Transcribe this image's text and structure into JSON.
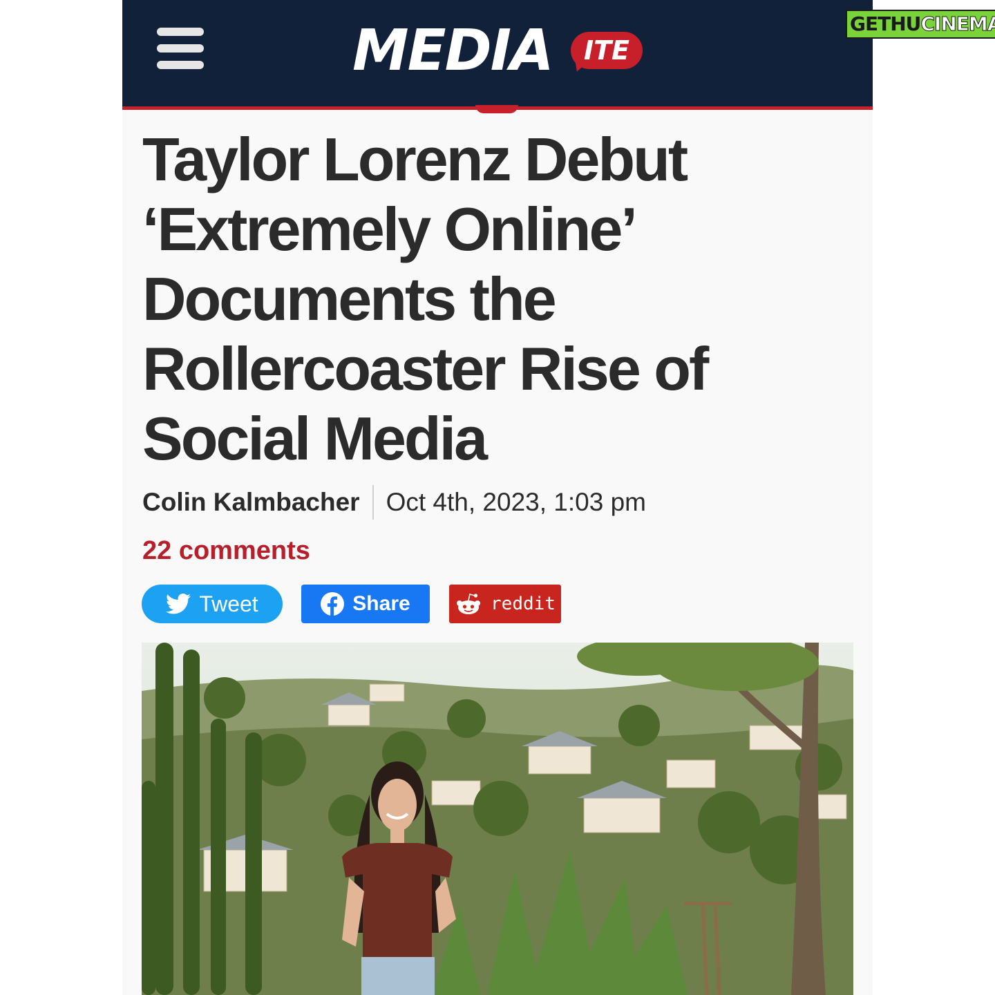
{
  "header": {
    "logo_main": "MEDIA",
    "logo_bubble": "ITE"
  },
  "watermark": {
    "part1": "GETHU",
    "part2": "CINEMA"
  },
  "article": {
    "headline": "Taylor Lorenz Debut ‘Extremely Online’ Documents the Rollercoaster Rise of Social Media",
    "author": "Colin Kalmbacher",
    "date": "Oct 4th, 2023, 1:03 pm",
    "comments": "22 comments"
  },
  "share": {
    "tweet_label": "Tweet",
    "facebook_label": "Share",
    "reddit_label": "reddit"
  },
  "colors": {
    "header_bg": "#12213a",
    "accent_red": "#c8202a",
    "twitter_blue": "#1da1f2",
    "facebook_blue": "#1877f2",
    "reddit_red": "#c8251e"
  },
  "icons": [
    "menu-icon",
    "twitter-bird-icon",
    "facebook-icon",
    "reddit-alien-icon"
  ]
}
